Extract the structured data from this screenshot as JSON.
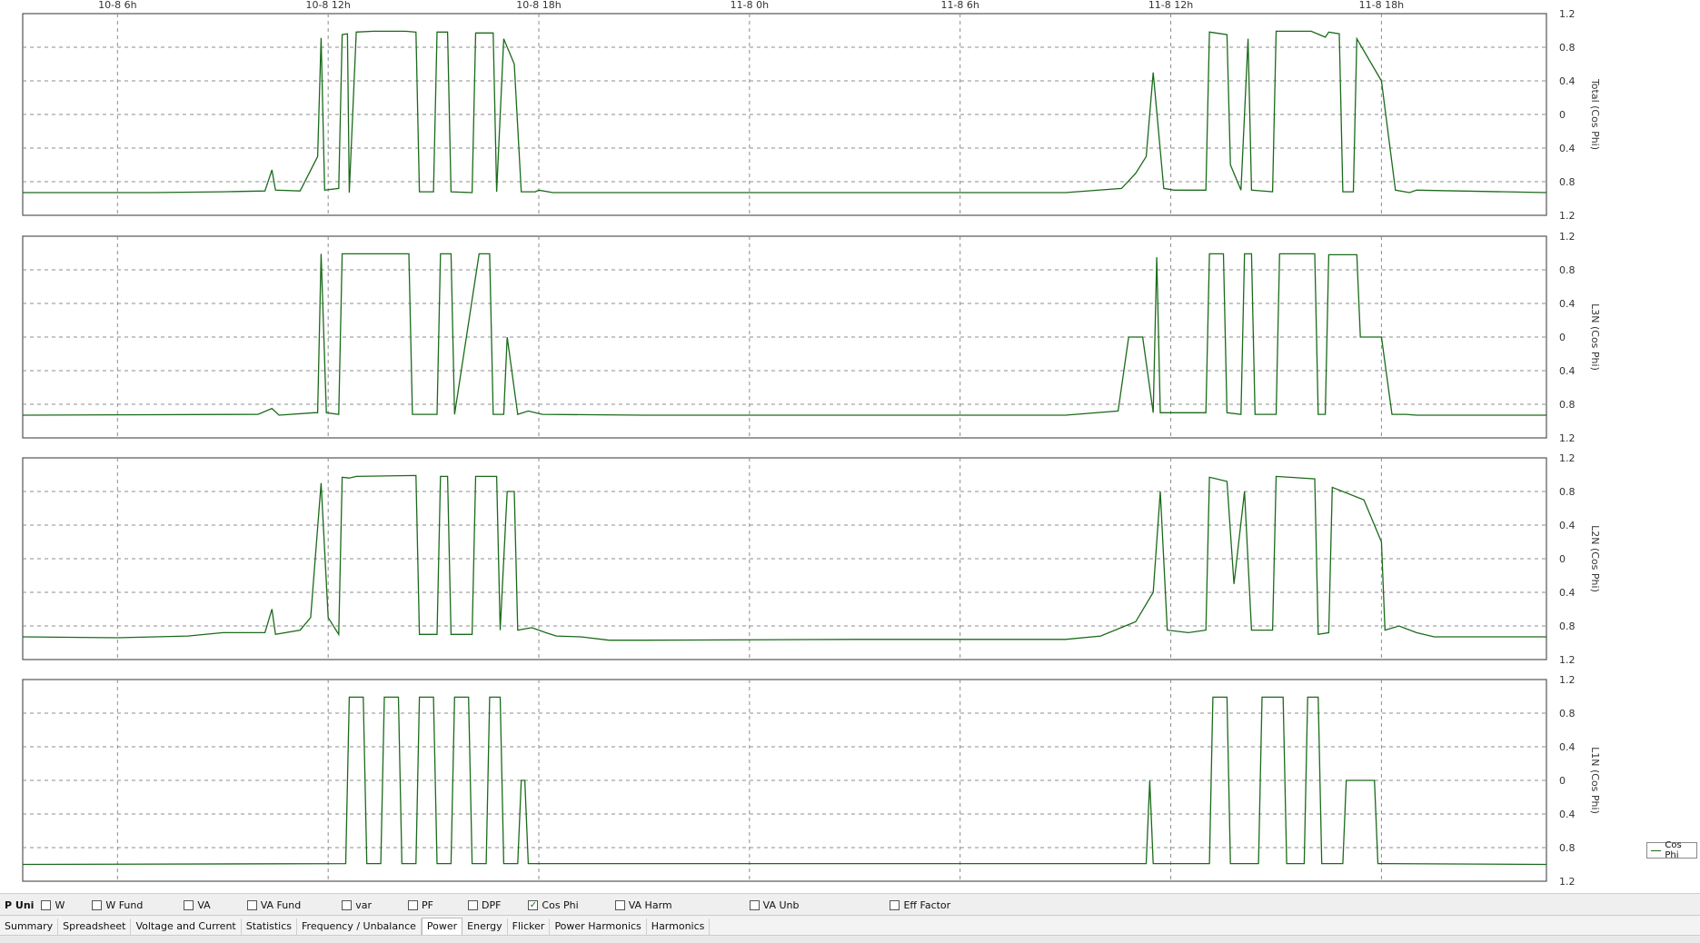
{
  "chart_data": {
    "type": "line",
    "x_ticks": [
      "10-8 6h",
      "10-8 12h",
      "10-8 18h",
      "11-8 0h",
      "11-8 6h",
      "11-8 12h",
      "11-8 18h"
    ],
    "x_range_hours": [
      3.3,
      46.7
    ],
    "y_ticks": [
      "1.2",
      "0.8",
      "0.4",
      "0",
      "0.4",
      "0.8",
      "1.2"
    ],
    "ylim": [
      -1.2,
      1.2
    ],
    "grid": true,
    "legend": "bottom-right",
    "line_color": "#1a6b1a",
    "series_name": "Cos Phi",
    "panels": [
      {
        "ylabel": "Total (Cos Phi)",
        "values": [
          [
            3.3,
            -0.93
          ],
          [
            7,
            -0.93
          ],
          [
            9,
            -0.92
          ],
          [
            10.2,
            -0.91
          ],
          [
            10.4,
            -0.66
          ],
          [
            10.5,
            -0.9
          ],
          [
            11.2,
            -0.91
          ],
          [
            11.7,
            -0.5
          ],
          [
            11.8,
            0.91
          ],
          [
            11.9,
            -0.9
          ],
          [
            12.3,
            -0.88
          ],
          [
            12.4,
            0.95
          ],
          [
            12.55,
            0.96
          ],
          [
            12.6,
            -0.93
          ],
          [
            12.8,
            0.98
          ],
          [
            13.3,
            0.99
          ],
          [
            14.2,
            0.99
          ],
          [
            14.5,
            0.98
          ],
          [
            14.6,
            -0.92
          ],
          [
            15,
            -0.92
          ],
          [
            15.1,
            0.98
          ],
          [
            15.4,
            0.98
          ],
          [
            15.5,
            -0.92
          ],
          [
            16.1,
            -0.93
          ],
          [
            16.2,
            0.97
          ],
          [
            16.7,
            0.97
          ],
          [
            16.8,
            -0.92
          ],
          [
            17,
            0.9
          ],
          [
            17.3,
            0.6
          ],
          [
            17.5,
            -0.92
          ],
          [
            17.9,
            -0.92
          ],
          [
            18,
            -0.9
          ],
          [
            18.4,
            -0.93
          ],
          [
            21,
            -0.93
          ],
          [
            27,
            -0.93
          ],
          [
            33,
            -0.93
          ],
          [
            34.6,
            -0.88
          ],
          [
            35,
            -0.7
          ],
          [
            35.3,
            -0.5
          ],
          [
            35.5,
            0.5
          ],
          [
            35.8,
            -0.88
          ],
          [
            36.1,
            -0.9
          ],
          [
            37,
            -0.9
          ],
          [
            37.1,
            0.98
          ],
          [
            37.6,
            0.95
          ],
          [
            37.7,
            -0.6
          ],
          [
            38,
            -0.9
          ],
          [
            38.2,
            0.9
          ],
          [
            38.3,
            -0.9
          ],
          [
            38.9,
            -0.92
          ],
          [
            39,
            0.99
          ],
          [
            40,
            0.99
          ],
          [
            40.4,
            0.92
          ],
          [
            40.5,
            0.98
          ],
          [
            40.8,
            0.96
          ],
          [
            40.9,
            -0.92
          ],
          [
            41.2,
            -0.92
          ],
          [
            41.3,
            0.9
          ],
          [
            42,
            0.4
          ],
          [
            42.4,
            -0.9
          ],
          [
            42.8,
            -0.93
          ],
          [
            43,
            -0.9
          ],
          [
            46.7,
            -0.93
          ]
        ]
      },
      {
        "ylabel": "L3N (Cos Phi)",
        "values": [
          [
            3.3,
            -0.93
          ],
          [
            10,
            -0.92
          ],
          [
            10.4,
            -0.85
          ],
          [
            10.6,
            -0.93
          ],
          [
            11.6,
            -0.9
          ],
          [
            11.7,
            -0.9
          ],
          [
            11.8,
            0.99
          ],
          [
            11.95,
            -0.9
          ],
          [
            12.3,
            -0.92
          ],
          [
            12.4,
            0.99
          ],
          [
            14.3,
            0.99
          ],
          [
            14.4,
            -0.92
          ],
          [
            15.1,
            -0.92
          ],
          [
            15.2,
            0.99
          ],
          [
            15.5,
            0.99
          ],
          [
            15.6,
            -0.92
          ],
          [
            16.3,
            0.99
          ],
          [
            16.6,
            0.99
          ],
          [
            16.7,
            -0.92
          ],
          [
            17,
            -0.92
          ],
          [
            17.1,
            0
          ],
          [
            17.4,
            -0.92
          ],
          [
            17.7,
            -0.88
          ],
          [
            18.1,
            -0.92
          ],
          [
            21,
            -0.93
          ],
          [
            27,
            -0.93
          ],
          [
            33,
            -0.93
          ],
          [
            34.5,
            -0.88
          ],
          [
            34.8,
            0
          ],
          [
            35.2,
            0
          ],
          [
            35.5,
            -0.9
          ],
          [
            35.6,
            0.95
          ],
          [
            35.7,
            -0.9
          ],
          [
            37,
            -0.9
          ],
          [
            37.1,
            0.99
          ],
          [
            37.5,
            0.99
          ],
          [
            37.6,
            -0.9
          ],
          [
            38,
            -0.92
          ],
          [
            38.1,
            0.99
          ],
          [
            38.3,
            0.99
          ],
          [
            38.4,
            -0.92
          ],
          [
            39,
            -0.92
          ],
          [
            39.1,
            0.99
          ],
          [
            40.1,
            0.99
          ],
          [
            40.2,
            -0.92
          ],
          [
            40.4,
            -0.92
          ],
          [
            40.5,
            0.98
          ],
          [
            41.3,
            0.98
          ],
          [
            41.4,
            0
          ],
          [
            42,
            0
          ],
          [
            42.3,
            -0.92
          ],
          [
            42.7,
            -0.92
          ],
          [
            43,
            -0.93
          ],
          [
            46.7,
            -0.93
          ]
        ]
      },
      {
        "ylabel": "L2N (Cos Phi)",
        "values": [
          [
            3.3,
            -0.93
          ],
          [
            6,
            -0.94
          ],
          [
            8,
            -0.92
          ],
          [
            9,
            -0.88
          ],
          [
            10.2,
            -0.88
          ],
          [
            10.4,
            -0.6
          ],
          [
            10.5,
            -0.9
          ],
          [
            11.2,
            -0.85
          ],
          [
            11.5,
            -0.7
          ],
          [
            11.8,
            0.9
          ],
          [
            12,
            -0.7
          ],
          [
            12.3,
            -0.9
          ],
          [
            12.4,
            0.97
          ],
          [
            12.6,
            0.96
          ],
          [
            12.8,
            0.98
          ],
          [
            14.5,
            0.99
          ],
          [
            14.6,
            -0.9
          ],
          [
            15.1,
            -0.9
          ],
          [
            15.2,
            0.98
          ],
          [
            15.4,
            0.98
          ],
          [
            15.5,
            -0.9
          ],
          [
            16.1,
            -0.9
          ],
          [
            16.2,
            0.98
          ],
          [
            16.8,
            0.98
          ],
          [
            16.9,
            -0.85
          ],
          [
            17.1,
            0.8
          ],
          [
            17.3,
            0.8
          ],
          [
            17.4,
            -0.85
          ],
          [
            17.8,
            -0.82
          ],
          [
            18.2,
            -0.88
          ],
          [
            18.5,
            -0.92
          ],
          [
            19.2,
            -0.93
          ],
          [
            20,
            -0.97
          ],
          [
            21,
            -0.97
          ],
          [
            27,
            -0.96
          ],
          [
            33,
            -0.96
          ],
          [
            34,
            -0.92
          ],
          [
            35,
            -0.75
          ],
          [
            35.5,
            -0.4
          ],
          [
            35.7,
            0.8
          ],
          [
            35.9,
            -0.85
          ],
          [
            36.5,
            -0.88
          ],
          [
            37,
            -0.85
          ],
          [
            37.1,
            0.97
          ],
          [
            37.6,
            0.92
          ],
          [
            37.8,
            -0.3
          ],
          [
            38.1,
            0.8
          ],
          [
            38.3,
            -0.85
          ],
          [
            38.9,
            -0.85
          ],
          [
            39,
            0.98
          ],
          [
            40.1,
            0.95
          ],
          [
            40.2,
            -0.9
          ],
          [
            40.5,
            -0.88
          ],
          [
            40.6,
            0.85
          ],
          [
            41.5,
            0.7
          ],
          [
            42,
            0.2
          ],
          [
            42.1,
            -0.85
          ],
          [
            42.5,
            -0.8
          ],
          [
            43,
            -0.88
          ],
          [
            43.5,
            -0.93
          ],
          [
            46.7,
            -0.93
          ]
        ]
      },
      {
        "ylabel": "L1N (Cos Phi)",
        "values": [
          [
            3.3,
            -1.0
          ],
          [
            12.5,
            -0.99
          ],
          [
            12.6,
            0.99
          ],
          [
            13,
            0.99
          ],
          [
            13.1,
            -0.99
          ],
          [
            13.5,
            -0.99
          ],
          [
            13.6,
            0.99
          ],
          [
            14,
            0.99
          ],
          [
            14.1,
            -0.99
          ],
          [
            14.5,
            -0.99
          ],
          [
            14.6,
            0.99
          ],
          [
            15,
            0.99
          ],
          [
            15.1,
            -0.99
          ],
          [
            15.5,
            -0.99
          ],
          [
            15.6,
            0.99
          ],
          [
            16,
            0.99
          ],
          [
            16.1,
            -0.99
          ],
          [
            16.5,
            -0.99
          ],
          [
            16.6,
            0.99
          ],
          [
            16.9,
            0.99
          ],
          [
            17,
            -0.99
          ],
          [
            17.4,
            -0.99
          ],
          [
            17.5,
            0
          ],
          [
            17.6,
            0
          ],
          [
            17.7,
            -0.99
          ],
          [
            35.3,
            -0.99
          ],
          [
            35.4,
            0
          ],
          [
            35.5,
            -0.99
          ],
          [
            37.1,
            -0.99
          ],
          [
            37.2,
            0.99
          ],
          [
            37.6,
            0.99
          ],
          [
            37.7,
            -0.99
          ],
          [
            38.5,
            -0.99
          ],
          [
            38.6,
            0.99
          ],
          [
            39.2,
            0.99
          ],
          [
            39.3,
            -0.99
          ],
          [
            39.8,
            -0.99
          ],
          [
            39.9,
            0.99
          ],
          [
            40.2,
            0.99
          ],
          [
            40.3,
            -0.99
          ],
          [
            40.9,
            -0.99
          ],
          [
            41,
            0
          ],
          [
            41.8,
            0
          ],
          [
            41.9,
            -0.99
          ],
          [
            46.7,
            -1.0
          ]
        ]
      }
    ]
  },
  "legend": {
    "label": "Cos Phi"
  },
  "toolbar": {
    "units_label": "P Uni",
    "checkboxes": [
      {
        "label": "W",
        "checked": false
      },
      {
        "label": "W Fund",
        "checked": false
      },
      {
        "label": "VA",
        "checked": false
      },
      {
        "label": "VA Fund",
        "checked": false
      },
      {
        "label": "var",
        "checked": false
      },
      {
        "label": "PF",
        "checked": false
      },
      {
        "label": "DPF",
        "checked": false
      },
      {
        "label": "Cos Phi",
        "checked": true
      },
      {
        "label": "VA Harm",
        "checked": false
      },
      {
        "label": "VA Unb",
        "checked": false
      },
      {
        "label": "Eff Factor",
        "checked": false
      }
    ]
  },
  "tabs": [
    {
      "label": "Summary",
      "active": false
    },
    {
      "label": "Spreadsheet",
      "active": false
    },
    {
      "label": "Voltage and Current",
      "active": false
    },
    {
      "label": "Statistics",
      "active": false
    },
    {
      "label": "Frequency / Unbalance",
      "active": false
    },
    {
      "label": "Power",
      "active": true
    },
    {
      "label": "Energy",
      "active": false
    },
    {
      "label": "Flicker",
      "active": false
    },
    {
      "label": "Power Harmonics",
      "active": false
    },
    {
      "label": "Harmonics",
      "active": false
    }
  ]
}
